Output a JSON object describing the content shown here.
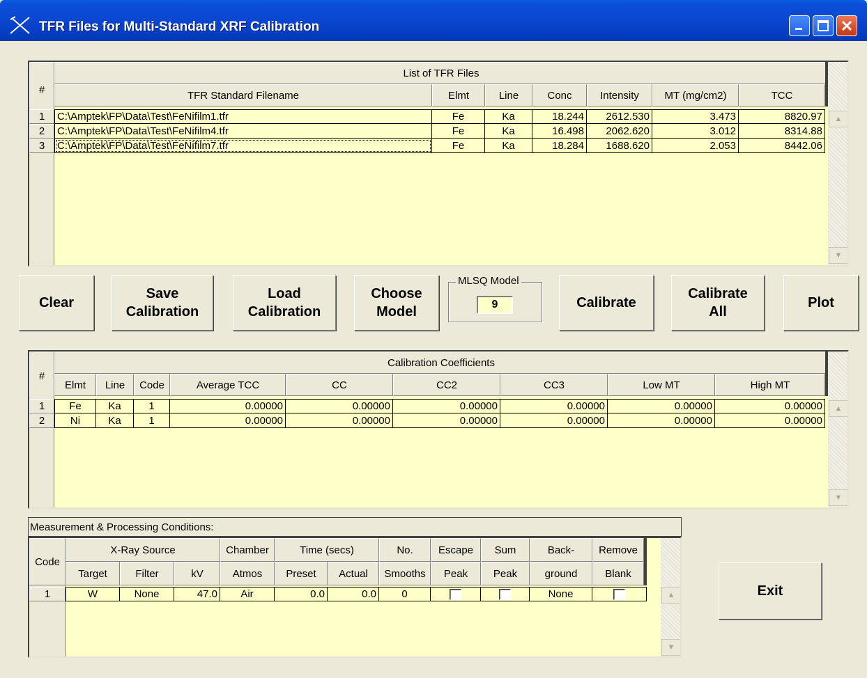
{
  "window": {
    "title": "TFR Files for Multi-Standard XRF Calibration"
  },
  "tfr": {
    "group_header": "List of TFR Files",
    "row_header_label": "#",
    "columns": [
      "TFR Standard Filename",
      "Elmt",
      "Line",
      "Conc",
      "Intensity",
      "MT (mg/cm2)",
      "TCC"
    ],
    "rows": [
      {
        "n": "1",
        "file": "C:\\Amptek\\FP\\Data\\Test\\FeNifilm1.tfr",
        "elmt": "Fe",
        "line": "Ka",
        "conc": "18.244",
        "intensity": "2612.530",
        "mt": "3.473",
        "tcc": "8820.97"
      },
      {
        "n": "2",
        "file": "C:\\Amptek\\FP\\Data\\Test\\FeNifilm4.tfr",
        "elmt": "Fe",
        "line": "Ka",
        "conc": "16.498",
        "intensity": "2062.620",
        "mt": "3.012",
        "tcc": "8314.88"
      },
      {
        "n": "3",
        "file": "C:\\Amptek\\FP\\Data\\Test\\FeNifilm7.tfr",
        "elmt": "Fe",
        "line": "Ka",
        "conc": "18.284",
        "intensity": "1688.620",
        "mt": "2.053",
        "tcc": "8442.06"
      }
    ]
  },
  "buttons": {
    "clear": "Clear",
    "save": "Save\nCalibration",
    "load": "Load\nCalibration",
    "choose": "Choose\nModel",
    "calibrate": "Calibrate",
    "calibrate_all": "Calibrate\nAll",
    "plot": "Plot",
    "exit": "Exit"
  },
  "mlsq": {
    "label": "MLSQ Model",
    "value": "9"
  },
  "coef": {
    "group_header": "Calibration Coefficients",
    "row_header_label": "#",
    "columns": [
      "Elmt",
      "Line",
      "Code",
      "Average TCC",
      "CC",
      "CC2",
      "CC3",
      "Low MT",
      "High MT"
    ],
    "rows": [
      {
        "n": "1",
        "elmt": "Fe",
        "line": "Ka",
        "code": "1",
        "avg": "0.00000",
        "cc": "0.00000",
        "cc2": "0.00000",
        "cc3": "0.00000",
        "low": "0.00000",
        "high": "0.00000"
      },
      {
        "n": "2",
        "elmt": "Ni",
        "line": "Ka",
        "code": "1",
        "avg": "0.00000",
        "cc": "0.00000",
        "cc2": "0.00000",
        "cc3": "0.00000",
        "low": "0.00000",
        "high": "0.00000"
      }
    ]
  },
  "meas": {
    "title": "Measurement & Processing Conditions:",
    "code_label": "Code",
    "groups": [
      "X-Ray Source",
      "Chamber",
      "Time (secs)",
      "No.",
      "Escape",
      "Sum",
      "Back-",
      "Remove"
    ],
    "subs": [
      "Target",
      "Filter",
      "kV",
      "Atmos",
      "Preset",
      "Actual",
      "Smooths",
      "Peak",
      "Peak",
      "ground",
      "Blank"
    ],
    "rows": [
      {
        "code": "1",
        "target": "W",
        "filter": "None",
        "kv": "47.0",
        "atmos": "Air",
        "preset": "0.0",
        "actual": "0.0",
        "smooths": "0",
        "escape": false,
        "sum": false,
        "background": "None",
        "blank": false
      }
    ]
  },
  "colors": {
    "grid_bg": "#ffffc8",
    "face": "#ece9d8",
    "titlebar": "#0b45cf"
  }
}
